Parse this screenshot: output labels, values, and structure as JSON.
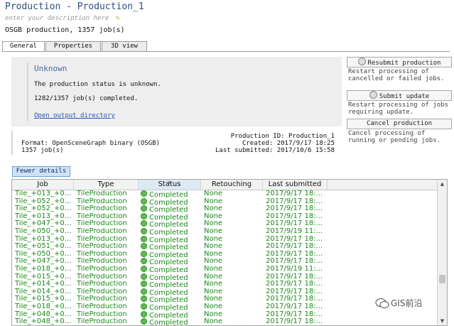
{
  "header": {
    "title": "Production - Production_1",
    "description_placeholder": "enter your description here",
    "summary": "OSGB production, 1357 job(s)"
  },
  "tabs": [
    {
      "label": "General",
      "active": true
    },
    {
      "label": "Properties",
      "active": false
    },
    {
      "label": "3D view",
      "active": false
    }
  ],
  "status": {
    "title": "Unknown",
    "text": "The production status is unknown.",
    "count": "1282/1357 job(s) completed.",
    "link": "Open output directory"
  },
  "info": {
    "format": "Format: OpenSceneGraph binary (OSGB)",
    "jobs": "1357 job(s)",
    "production_id": "Production ID: Production_1",
    "created": "Created: 2017/9/17 18:25",
    "last_submitted": "Last submitted: 2017/10/6 15:58"
  },
  "actions": [
    {
      "label": "Resubmit production",
      "icon": "resubmit-icon",
      "desc": "Restart processing of cancelled or failed jobs."
    },
    {
      "label": "Submit update",
      "icon": "update-icon",
      "desc": "Restart processing of jobs requiring update."
    },
    {
      "label": "Cancel production",
      "icon": "",
      "desc": "Cancel processing of running or pending jobs."
    }
  ],
  "fewer_details": "Fewer details",
  "table": {
    "columns": [
      "Job",
      "Type",
      "Status",
      "Retouching",
      "Last submitted"
    ],
    "sorted_column": "Status",
    "status_color": "#1c8a1c",
    "rows": [
      [
        "Tile_+013_+0...",
        "TileProduction",
        "Completed",
        "None",
        "2017/9/17 18:..."
      ],
      [
        "Tile_+052_+0...",
        "TileProduction",
        "Completed",
        "None",
        "2017/9/17 18:..."
      ],
      [
        "Tile_+052_+0...",
        "TileProduction",
        "Completed",
        "None",
        "2017/9/17 18:..."
      ],
      [
        "Tile_+013_+0...",
        "TileProduction",
        "Completed",
        "None",
        "2017/9/17 18:..."
      ],
      [
        "Tile_+047_+0...",
        "TileProduction",
        "Completed",
        "None",
        "2017/9/17 18:..."
      ],
      [
        "Tile_+050_+0...",
        "TileProduction",
        "Completed",
        "None",
        "2017/9/19 11:..."
      ],
      [
        "Tile_+013_+0...",
        "TileProduction",
        "Completed",
        "None",
        "2017/9/17 18:..."
      ],
      [
        "Tile_+051_+0...",
        "TileProduction",
        "Completed",
        "None",
        "2017/9/17 18:..."
      ],
      [
        "Tile_+050_+0...",
        "TileProduction",
        "Completed",
        "None",
        "2017/9/17 18:..."
      ],
      [
        "Tile_+047_+0...",
        "TileProduction",
        "Completed",
        "None",
        "2017/9/17 18:..."
      ],
      [
        "Tile_+018_+0...",
        "TileProduction",
        "Completed",
        "None",
        "2017/9/19 11:..."
      ],
      [
        "Tile_+015_+0...",
        "TileProduction",
        "Completed",
        "None",
        "2017/9/17 18:..."
      ],
      [
        "Tile_+014_+0...",
        "TileProduction",
        "Completed",
        "None",
        "2017/9/17 18:..."
      ],
      [
        "Tile_+014_+0...",
        "TileProduction",
        "Completed",
        "None",
        "2017/9/17 18:..."
      ],
      [
        "Tile_+015_+0...",
        "TileProduction",
        "Completed",
        "None",
        "2017/9/17 18:..."
      ],
      [
        "Tile_+018_+0...",
        "TileProduction",
        "Completed",
        "None",
        "2017/9/17 18:..."
      ],
      [
        "Tile_+048_+0...",
        "TileProduction",
        "Completed",
        "None",
        "2017/9/17 18:..."
      ],
      [
        "Tile_+048_+0...",
        "TileProduction",
        "Completed",
        "None",
        "2017/9/17 18:..."
      ]
    ]
  },
  "watermark": "GIS前沿"
}
